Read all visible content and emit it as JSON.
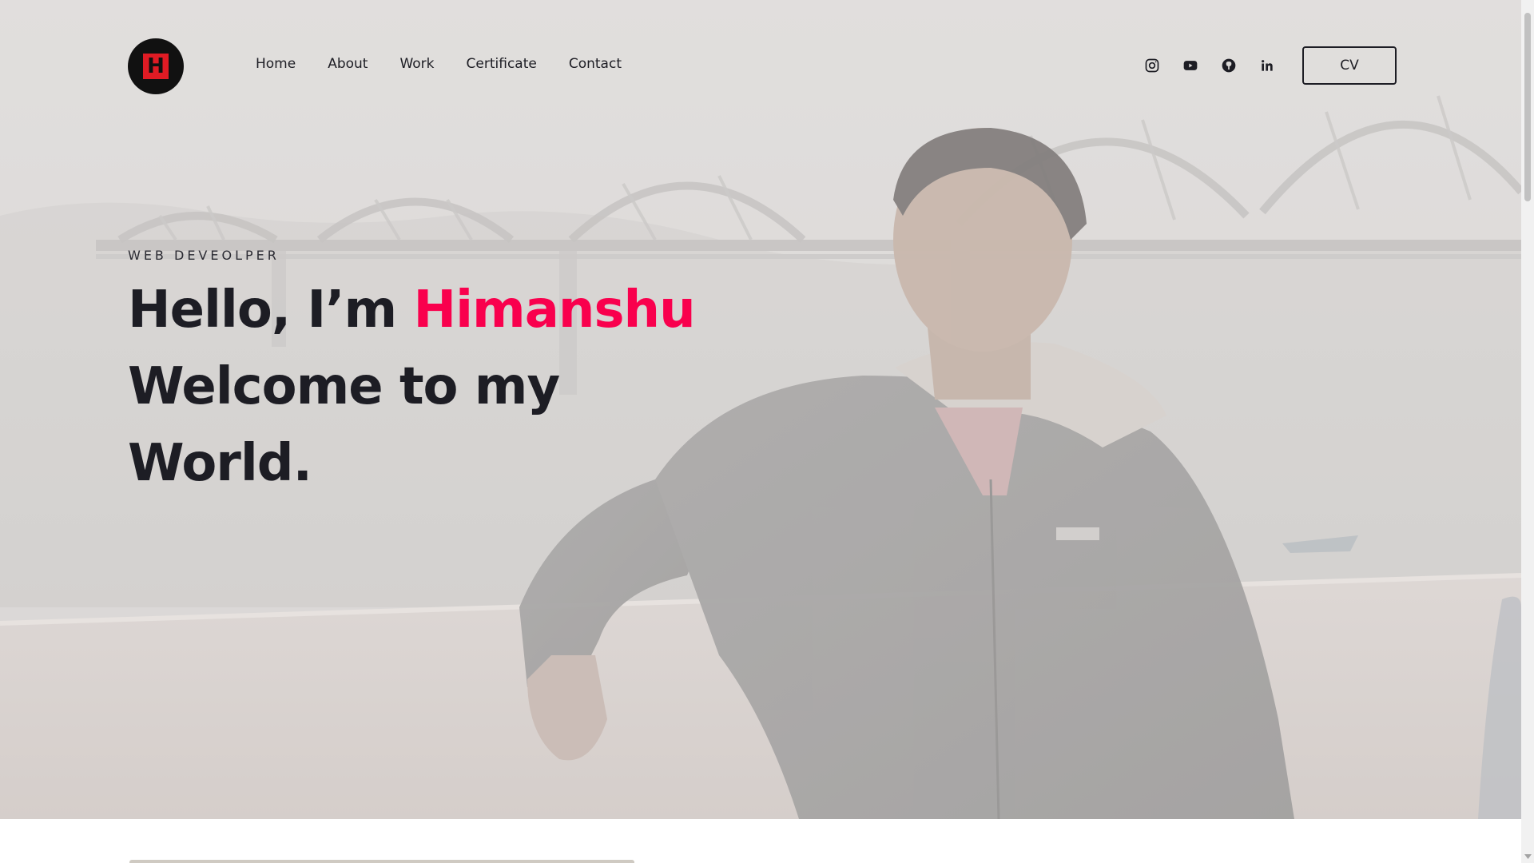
{
  "brand": {
    "logo_letter": "H",
    "logo_accent": "#e01b24"
  },
  "nav": {
    "items": [
      {
        "label": "Home"
      },
      {
        "label": "About"
      },
      {
        "label": "Work"
      },
      {
        "label": "Certificate"
      },
      {
        "label": "Contact"
      }
    ]
  },
  "social": {
    "icons": [
      "instagram-icon",
      "youtube-icon",
      "github-icon",
      "linkedin-icon"
    ]
  },
  "cv_button": {
    "label": "CV"
  },
  "hero": {
    "subtitle": "WEB DEVEOLPER",
    "greeting": "Hello, I’m ",
    "name": "Himanshu",
    "line2": "Welcome to my",
    "line3": "World.",
    "accent_color": "#f9004d",
    "text_color": "#1d1d24"
  }
}
